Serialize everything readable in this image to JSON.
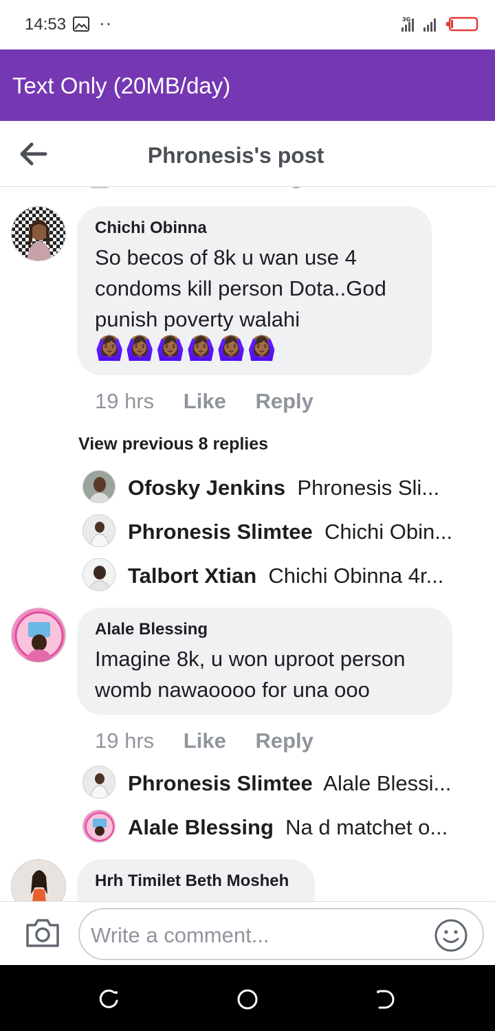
{
  "status_bar": {
    "time": "14:53",
    "icons": [
      "image-icon",
      "more-dots-icon",
      "signal-icon",
      "battery-icon"
    ],
    "network": "3G"
  },
  "banner": {
    "text": "Text Only (20MB/day)",
    "color": "#7537b2"
  },
  "header": {
    "title": "Phronesis's post"
  },
  "comments": [
    {
      "author": "Chichi Obinna",
      "text": "So becos of 8k u wan use 4 condoms kill person Dota..God punish poverty walahi",
      "emoji": "🙆🏾‍♀️🙆🏾‍♀️🙆🏾‍♀️🙆🏾‍♀️🙆🏾‍♀️🙆🏾‍♀️",
      "time": "19 hrs",
      "like": "Like",
      "reply": "Reply",
      "view_previous": "View previous 8 replies",
      "replies": [
        {
          "name": "Ofosky Jenkins",
          "snippet": "Phronesis Sli..."
        },
        {
          "name": "Phronesis Slimtee",
          "snippet": "Chichi Obin..."
        },
        {
          "name": "Talbort Xtian",
          "snippet": "Chichi Obinna 4r..."
        }
      ]
    },
    {
      "author": "Alale Blessing",
      "text": "Imagine 8k, u won uproot person womb nawaoooo for una ooo",
      "time": "19 hrs",
      "like": "Like",
      "reply": "Reply",
      "replies": [
        {
          "name": "Phronesis Slimtee",
          "snippet": "Alale Blessi..."
        },
        {
          "name": "Alale Blessing",
          "snippet": "Na d matchet o..."
        }
      ]
    },
    {
      "author": "Hrh Timilet Beth Mosheh"
    }
  ],
  "composer": {
    "placeholder": "Write a comment..."
  }
}
